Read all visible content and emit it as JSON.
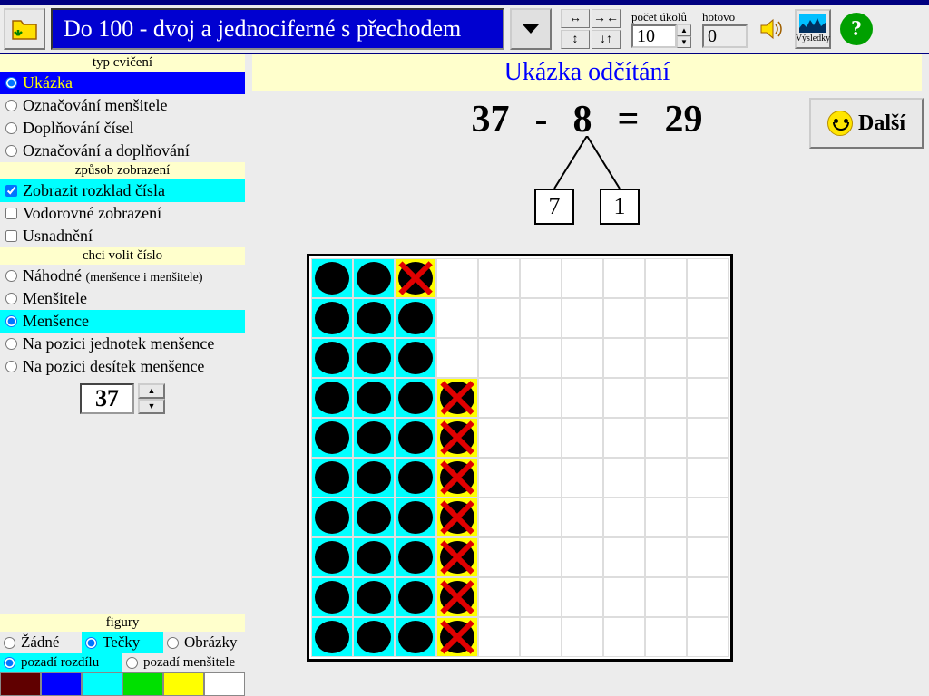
{
  "toolbar": {
    "dropdown_text": "Do 100 - dvoj a jednociferné s přechodem",
    "pocet_label": "počet úkolů",
    "pocet_value": "10",
    "hotovo_label": "hotovo",
    "hotovo_value": "0",
    "vysledky_label": "Výsledky"
  },
  "sidebar": {
    "typ_h": "typ cvičení",
    "typ": [
      "Ukázka",
      "Označování menšitele",
      "Doplňování čísel",
      "Označování a doplňování"
    ],
    "zpusob_h": "způsob zobrazení",
    "zpusob": [
      "Zobrazit rozklad čísla",
      "Vodorovné zobrazení",
      "Usnadnění"
    ],
    "volit_h": "chci volit číslo",
    "volit_0a": "Náhodné ",
    "volit_0b": "(menšence i menšitele)",
    "volit": [
      "Menšitele",
      "Menšence",
      "Na pozici jednotek menšence",
      "Na pozici desítek menšence"
    ],
    "num_value": "37",
    "fig_h": "figury",
    "fig": [
      "Žádné",
      "Tečky",
      "Obrázky"
    ],
    "bg": [
      "pozadí rozdílu",
      "pozadí menšitele"
    ],
    "colors": [
      "#600000",
      "#0000ff",
      "#00ffff",
      "#00e000",
      "#ffff00",
      "#ffffff"
    ]
  },
  "main": {
    "title": "Ukázka odčítání",
    "minuend": "37",
    "minus": "-",
    "subtrahend": "8",
    "equals": "=",
    "result": "29",
    "split1": "7",
    "split2": "1",
    "next": "Další"
  },
  "grid": {
    "rows": 10,
    "cols": 10,
    "cells": [
      [
        "cd",
        "cd",
        "yx",
        "",
        "",
        "",
        "",
        "",
        "",
        ""
      ],
      [
        "cd",
        "cd",
        "cd",
        "",
        "",
        "",
        "",
        "",
        "",
        ""
      ],
      [
        "cd",
        "cd",
        "cd",
        "",
        "",
        "",
        "",
        "",
        "",
        ""
      ],
      [
        "cd",
        "cd",
        "cd",
        "yx",
        "",
        "",
        "",
        "",
        "",
        ""
      ],
      [
        "cd",
        "cd",
        "cd",
        "yx",
        "",
        "",
        "",
        "",
        "",
        ""
      ],
      [
        "cd",
        "cd",
        "cd",
        "yx",
        "",
        "",
        "",
        "",
        "",
        ""
      ],
      [
        "cd",
        "cd",
        "cd",
        "yx",
        "",
        "",
        "",
        "",
        "",
        ""
      ],
      [
        "cd",
        "cd",
        "cd",
        "yx",
        "",
        "",
        "",
        "",
        "",
        ""
      ],
      [
        "cd",
        "cd",
        "cd",
        "yx",
        "",
        "",
        "",
        "",
        "",
        ""
      ],
      [
        "cd",
        "cd",
        "cd",
        "yx",
        "",
        "",
        "",
        "",
        "",
        ""
      ]
    ]
  }
}
